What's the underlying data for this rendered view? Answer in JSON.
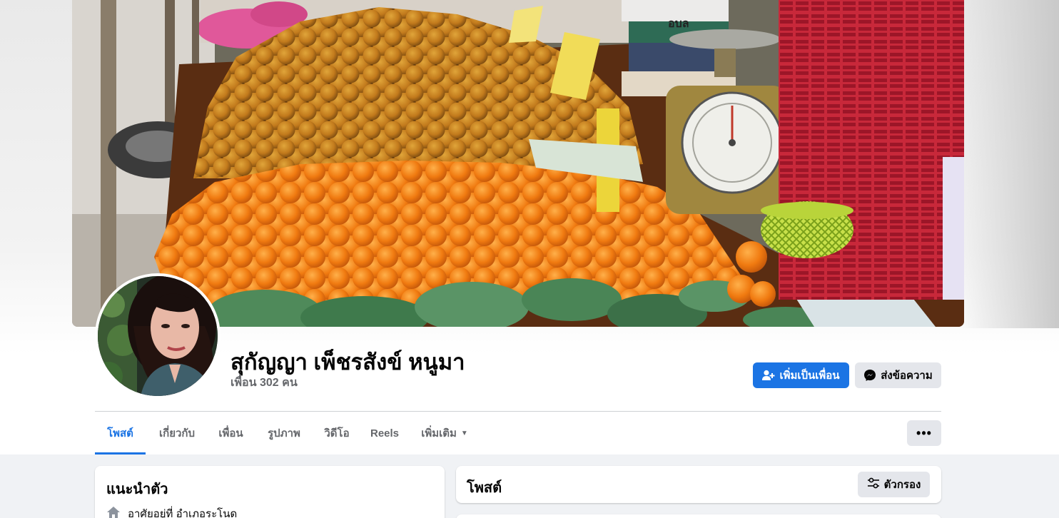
{
  "profile": {
    "name": "สุกัญญา เพ็ชรสังข์ หนูมา",
    "friends_count": "เพื่อน 302 คน"
  },
  "actions": {
    "add_friend": "เพิ่มเป็นเพื่อน",
    "message": "ส่งข้อความ"
  },
  "tabs": [
    {
      "label": "โพสต์",
      "active": true
    },
    {
      "label": "เกี่ยวกับ",
      "active": false
    },
    {
      "label": "เพื่อน",
      "active": false
    },
    {
      "label": "รูปภาพ",
      "active": false
    },
    {
      "label": "วิดีโอ",
      "active": false
    },
    {
      "label": "Reels",
      "active": false
    },
    {
      "label": "เพิ่มเติม",
      "active": false
    }
  ],
  "more_menu_icon": "ellipsis-icon",
  "intro": {
    "title": "แนะนำตัว",
    "lives_in": "อาศัยอยู่ที่ อำเภอระโนด"
  },
  "posts": {
    "title": "โพสต์",
    "filter_label": "ตัวกรอง"
  },
  "colors": {
    "accent": "#1b74e4",
    "button_gray": "#e4e6eb",
    "secondary_text": "#65676b",
    "page_bg": "#f0f2f5"
  },
  "cover_scale_text": "อบล"
}
